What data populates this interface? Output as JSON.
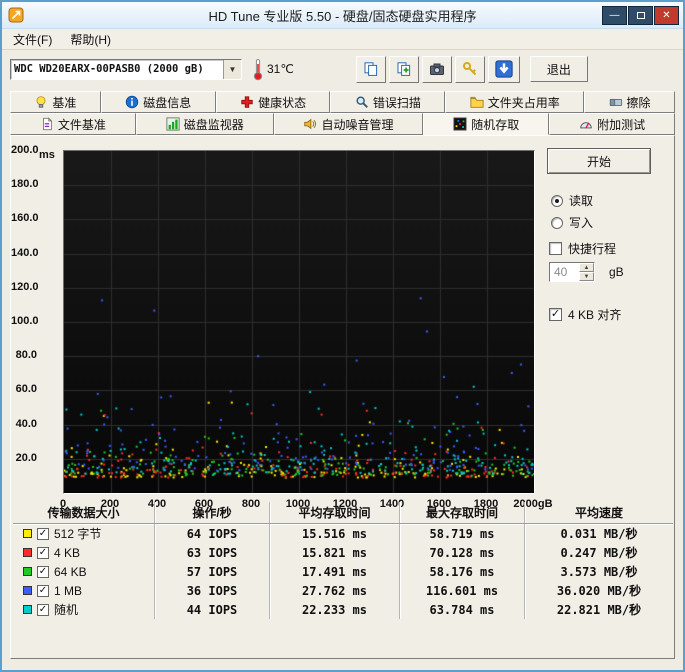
{
  "window": {
    "title": "HD Tune 专业版 5.50 - 硬盘/固态硬盘实用程序"
  },
  "menu": {
    "items": [
      {
        "name": "menu-file",
        "label": "文件(F)"
      },
      {
        "name": "menu-help",
        "label": "帮助(H)"
      }
    ]
  },
  "toolbar": {
    "drive_select_value": "WDC WD20EARX-00PASB0  (2000 gB)",
    "temperature": "31℃",
    "exit_label": "退出",
    "icon_buttons": [
      "copy-icon",
      "copy-add-icon",
      "camera-icon",
      "keys-icon",
      "download-icon"
    ]
  },
  "tabs": {
    "row1": [
      {
        "name": "tab-benchmark",
        "icon": "lightbulb-icon",
        "label": "基准"
      },
      {
        "name": "tab-disk-info",
        "icon": "info-icon",
        "label": "磁盘信息"
      },
      {
        "name": "tab-health",
        "icon": "health-cross-icon",
        "label": "健康状态"
      },
      {
        "name": "tab-error-scan",
        "icon": "magnifier-icon",
        "label": "错误扫描"
      },
      {
        "name": "tab-folder-usage",
        "icon": "folder-icon",
        "label": "文件夹占用率"
      },
      {
        "name": "tab-erase",
        "icon": "eraser-icon",
        "label": "擦除"
      }
    ],
    "row2": [
      {
        "name": "tab-file-benchmark",
        "icon": "file-icon",
        "label": "文件基准"
      },
      {
        "name": "tab-disk-monitor",
        "icon": "bar-chart-icon",
        "label": "磁盘监视器"
      },
      {
        "name": "tab-aam",
        "icon": "speaker-icon",
        "label": "自动噪音管理"
      },
      {
        "name": "tab-random-access",
        "icon": "scatter-icon",
        "label": "随机存取",
        "active": true
      },
      {
        "name": "tab-extra-tests",
        "icon": "gauge-icon",
        "label": "附加测试"
      }
    ]
  },
  "panel": {
    "start_label": "开始",
    "read_label": "读取",
    "write_label": "写入",
    "short_stroke_label": "快捷行程",
    "short_stroke_value": "40",
    "short_stroke_unit": "gB",
    "align_label": "4 KB 对齐",
    "read_checked": true,
    "write_checked": false,
    "short_stroke_checked": false,
    "align_checked": true
  },
  "chart_data": {
    "type": "scatter",
    "title": "随机存取 access time scatter",
    "ylabel": "ms",
    "xlim": [
      0,
      2000
    ],
    "ylim": [
      0,
      200
    ],
    "grid": true,
    "bg": "#0d0d0d",
    "grid_color": "#2e2e2e",
    "y_tick_labels": [
      "200.0",
      "180.0",
      "160.0",
      "140.0",
      "120.0",
      "100.0",
      "80.0",
      "60.0",
      "40.0",
      "20.0"
    ],
    "x_tick_labels": [
      "0",
      "200",
      "400",
      "600",
      "800",
      "1000",
      "1200",
      "1400",
      "1600",
      "1800",
      "2000gB"
    ],
    "series": [
      {
        "name": "512 字节",
        "color": "#ffee00",
        "avg_ms": 15.516,
        "max_ms": 58.719,
        "points": 160,
        "base_ms": 9,
        "tail_ms": 6,
        "seed": 11
      },
      {
        "name": "4 KB",
        "color": "#ff2a2a",
        "avg_ms": 15.821,
        "max_ms": 70.128,
        "points": 160,
        "base_ms": 9,
        "tail_ms": 6.5,
        "seed": 22
      },
      {
        "name": "64 KB",
        "color": "#22c922",
        "avg_ms": 17.491,
        "max_ms": 58.176,
        "points": 155,
        "base_ms": 10,
        "tail_ms": 7,
        "seed": 33
      },
      {
        "name": "1 MB",
        "color": "#3d5bff",
        "avg_ms": 27.762,
        "max_ms": 116.601,
        "points": 150,
        "base_ms": 13,
        "tail_ms": 14,
        "seed": 44
      },
      {
        "name": "随机",
        "color": "#00cccc",
        "avg_ms": 22.233,
        "max_ms": 63.784,
        "points": 155,
        "base_ms": 11,
        "tail_ms": 10,
        "seed": 55
      }
    ]
  },
  "table": {
    "headers": [
      "传输数据大小",
      "操作/秒",
      "平均存取时间",
      "最大存取时间",
      "平均速度"
    ],
    "rows": [
      {
        "color": "#ffee00",
        "checked": true,
        "label": "512 字节",
        "iops": "64 IOPS",
        "avg": "15.516 ms",
        "max": "58.719 ms",
        "speed": "0.031 MB/秒"
      },
      {
        "color": "#ff2a2a",
        "checked": true,
        "label": "4 KB",
        "iops": "63 IOPS",
        "avg": "15.821 ms",
        "max": "70.128 ms",
        "speed": "0.247 MB/秒"
      },
      {
        "color": "#22c922",
        "checked": true,
        "label": "64 KB",
        "iops": "57 IOPS",
        "avg": "17.491 ms",
        "max": "58.176 ms",
        "speed": "3.573 MB/秒"
      },
      {
        "color": "#3d5bff",
        "checked": true,
        "label": "1 MB",
        "iops": "36 IOPS",
        "avg": "27.762 ms",
        "max": "116.601 ms",
        "speed": "36.020 MB/秒"
      },
      {
        "color": "#00cccc",
        "checked": true,
        "label": "随机",
        "iops": "44 IOPS",
        "avg": "22.233 ms",
        "max": "63.784 ms",
        "speed": "22.821 MB/秒"
      }
    ]
  }
}
